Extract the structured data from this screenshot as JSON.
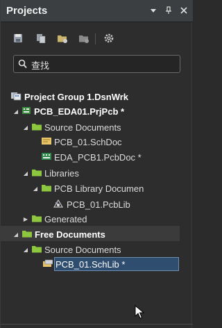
{
  "panel": {
    "title": "Projects",
    "title_buttons": [
      "menu-down-icon",
      "pin-icon",
      "close-icon"
    ]
  },
  "toolbar": {
    "tools": [
      "save-icon",
      "copy-icon",
      "open-folder-icon",
      "close-folder-icon",
      "settings-gear-icon"
    ]
  },
  "search": {
    "value": "查找",
    "placeholder": ""
  },
  "tree": {
    "group": "Project Group 1.DsnWrk",
    "project": "PCB_EDA01.PrjPcb *",
    "source_docs": "Source Documents",
    "schdoc": "PCB_01.SchDoc",
    "pcbdoc": "EDA_PCB1.PcbDoc *",
    "libraries": "Libraries",
    "pcb_lib_docs": "PCB Library Documen",
    "pcblib": "PCB_01.PcbLib",
    "generated": "Generated",
    "free_docs": "Free Documents",
    "free_source_docs": "Source Documents",
    "schlib": "PCB_01.SchLib *"
  },
  "colors": {
    "folder": "#8dc63f",
    "background": "#2d2d2d",
    "selection": "#2f4d6e",
    "selection_border": "#6d8fb5"
  }
}
